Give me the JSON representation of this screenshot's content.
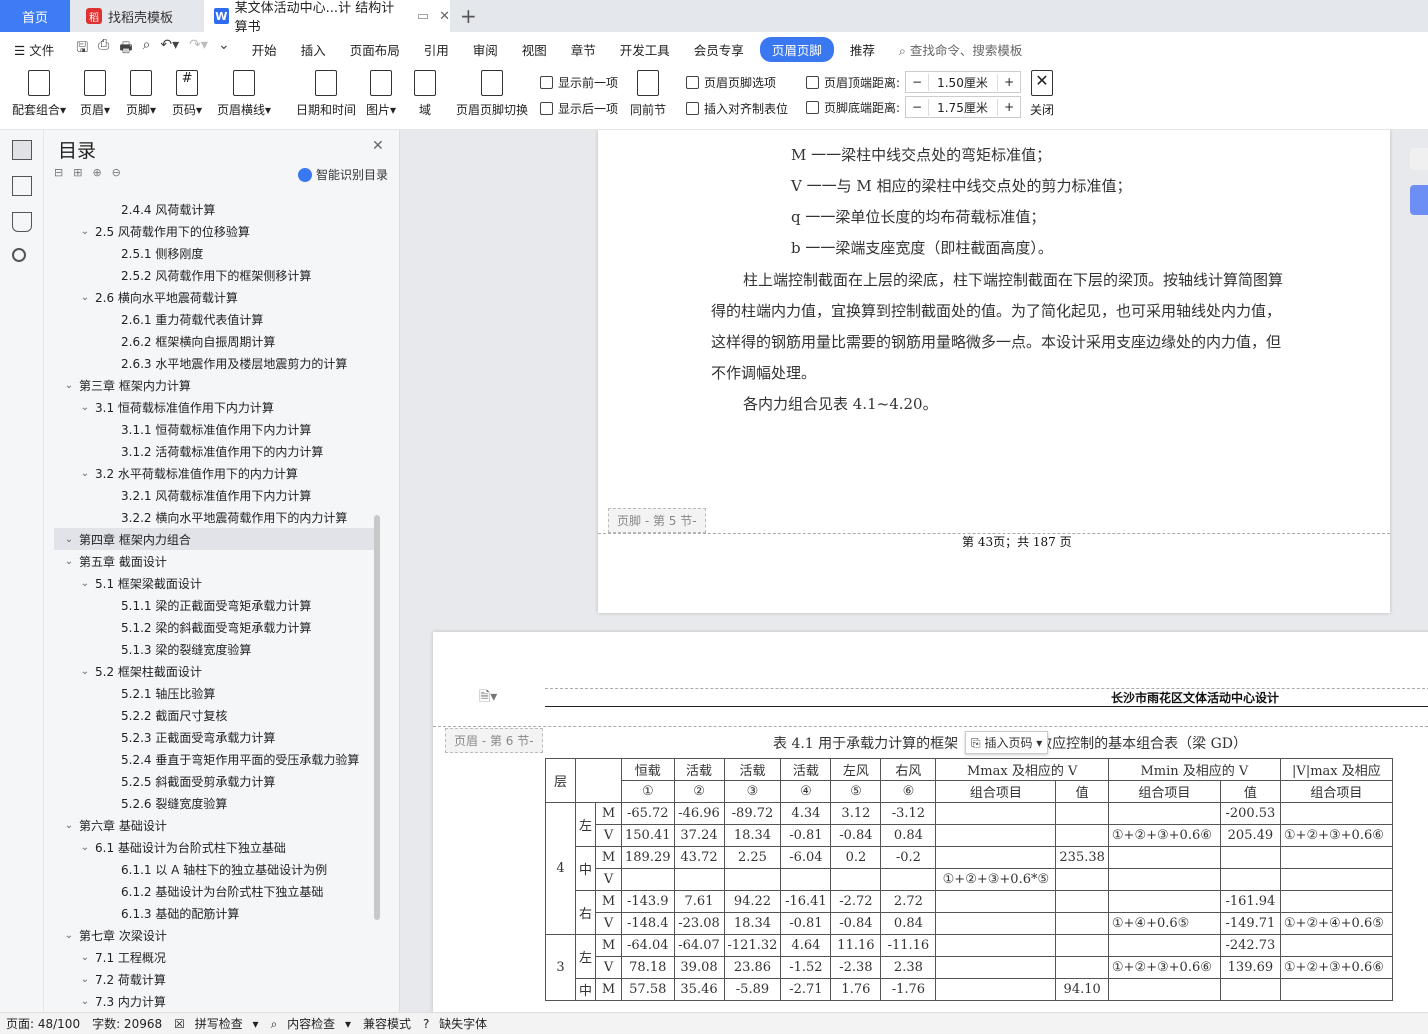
{
  "tabs": {
    "home": "首页",
    "template": "找稻壳模板",
    "doc": "某文体活动中心...计 结构计算书",
    "add": "+"
  },
  "menu": {
    "file": "文件",
    "items": [
      "开始",
      "插入",
      "页面布局",
      "引用",
      "审阅",
      "视图",
      "章节",
      "开发工具",
      "会员专享"
    ],
    "active": "页眉页脚",
    "recommend": "推荐",
    "search": "查找命令、搜索模板"
  },
  "toolbar": {
    "combo": "配套组合",
    "header": "页眉",
    "footer": "页脚",
    "pagenum": "页码",
    "headerline": "页眉横线",
    "datetime": "日期和时间",
    "image": "图片",
    "field": "域",
    "switch": "页眉页脚切换",
    "prev": "显示前一项",
    "next": "显示后一项",
    "same": "同前节",
    "options": "页眉页脚选项",
    "align_tab": "插入对齐制表位",
    "top_dist_label": "页眉顶端距离:",
    "top_dist": "1.50厘米",
    "bottom_dist_label": "页脚底端距离:",
    "bottom_dist": "1.75厘米",
    "close": "关闭"
  },
  "toc": {
    "title": "目录",
    "smart": "智能识别目录",
    "items": [
      {
        "t": "2.4.4  风荷载计算",
        "lvl": 3
      },
      {
        "t": "2.5  风荷载作用下的位移验算",
        "lvl": 2
      },
      {
        "t": "2.5.1  侧移刚度",
        "lvl": 3
      },
      {
        "t": "2.5.2  风荷载作用下的框架侧移计算",
        "lvl": 3
      },
      {
        "t": "2.6  横向水平地震荷载计算",
        "lvl": 2
      },
      {
        "t": "2.6.1  重力荷载代表值计算",
        "lvl": 3
      },
      {
        "t": "2.6.2  框架横向自振周期计算",
        "lvl": 3
      },
      {
        "t": "2.6.3 水平地震作用及楼层地震剪力的计算",
        "lvl": 3
      },
      {
        "t": "第三章  框架内力计算",
        "lvl": 1
      },
      {
        "t": "3.1  恒荷载标准值作用下内力计算",
        "lvl": 2
      },
      {
        "t": "3.1.1  恒荷载标准值作用下内力计算",
        "lvl": 3
      },
      {
        "t": "3.1.2  活荷载标准值作用下的内力计算",
        "lvl": 3
      },
      {
        "t": "3.2  水平荷载标准值作用下的内力计算",
        "lvl": 2
      },
      {
        "t": "3.2.1  风荷载标准值作用下内力计算",
        "lvl": 3
      },
      {
        "t": "3.2.2  横向水平地震荷载作用下的内力计算",
        "lvl": 3
      },
      {
        "t": "第四章  框架内力组合",
        "lvl": 1,
        "sel": true
      },
      {
        "t": "第五章  截面设计",
        "lvl": 1
      },
      {
        "t": "5.1  框架梁截面设计",
        "lvl": 2
      },
      {
        "t": "5.1.1  梁的正截面受弯矩承载力计算",
        "lvl": 3
      },
      {
        "t": "5.1.2  梁的斜截面受弯矩承载力计算",
        "lvl": 3
      },
      {
        "t": "5.1.3  梁的裂缝宽度验算",
        "lvl": 3
      },
      {
        "t": "5.2  框架柱截面设计",
        "lvl": 2
      },
      {
        "t": "5.2.1  轴压比验算",
        "lvl": 3
      },
      {
        "t": "5.2.2  截面尺寸复核",
        "lvl": 3
      },
      {
        "t": "5.2.3  正截面受弯承载力计算",
        "lvl": 3
      },
      {
        "t": "5.2.4  垂直于弯矩作用平面的受压承载力验算",
        "lvl": 3
      },
      {
        "t": "5.2.5  斜截面受剪承载力计算",
        "lvl": 3
      },
      {
        "t": "5.2.6  裂缝宽度验算",
        "lvl": 3
      },
      {
        "t": "第六章  基础设计",
        "lvl": 1
      },
      {
        "t": "6.1 基础设计为台阶式柱下独立基础",
        "lvl": 2
      },
      {
        "t": "6.1.1 以 A 轴柱下的独立基础设计为例",
        "lvl": 3
      },
      {
        "t": "6.1.2 基础设计为台阶式柱下独立基础",
        "lvl": 3
      },
      {
        "t": "6.1.3 基础的配筋计算",
        "lvl": 3
      },
      {
        "t": "第七章  次梁设计",
        "lvl": 1
      },
      {
        "t": "7.1  工程概况",
        "lvl": 2
      },
      {
        "t": "7.2  荷载计算",
        "lvl": 2
      },
      {
        "t": "7.3  内力计算",
        "lvl": 2
      }
    ]
  },
  "page5": {
    "lines": [
      "M 一一梁柱中线交点处的弯矩标准值；",
      "V 一一与 M 相应的梁柱中线交点处的剪力标准值；",
      "q 一一梁单位长度的均布荷载标准值；",
      "b 一一梁端支座宽度（即柱截面高度）。"
    ],
    "para": [
      "柱上端控制截面在上层的梁底，柱下端控制截面在下层的梁顶。按轴线计算简图算",
      "得的柱端内力值，宜换算到控制截面处的值。为了简化起见，也可采用轴线处内力值，",
      "这样得的钢筋用量比需要的钢筋用量略微多一点。本设计采用支座边缘处的内力值，但",
      "不作调幅处理。"
    ],
    "para2": "各内力组合见表 4.1~4.20。",
    "footer_label": "页脚 - 第 5 节-",
    "footer_text": "第 43页；共 187 页"
  },
  "page6": {
    "header_label": "页眉 - 第 6 节-",
    "header_text": "长沙市雨花区文体活动中心设计",
    "insert_pagenum": "插入页码",
    "table_title_a": "表 4.1    用于承载力计算的框架",
    "table_title_b": "效应控制的基本组合表（梁 GD）",
    "head1": [
      "层",
      "",
      "恒载",
      "活载",
      "活载",
      "活载",
      "左风",
      "右风",
      "Mmax 及相应的 V",
      "",
      "Mmin 及相应的 V",
      "",
      "|V|max 及相应"
    ],
    "head2": [
      "①",
      "②",
      "③",
      "④",
      "⑤",
      "⑥",
      "组合项目",
      "值",
      "组合项目",
      "值",
      "组合项目"
    ],
    "rows": [
      [
        "4",
        "左",
        "M",
        "-65.72",
        "-46.96",
        "-89.72",
        "4.34",
        "3.12",
        "-3.12",
        "",
        "",
        "",
        "-200.53",
        ""
      ],
      [
        "",
        "",
        "V",
        "150.41",
        "37.24",
        "18.34",
        "-0.81",
        "-0.84",
        "0.84",
        "",
        "",
        "①+②+③+0.6⑥",
        "205.49",
        "①+②+③+0.6⑥"
      ],
      [
        "",
        "中",
        "M",
        "189.29",
        "43.72",
        "2.25",
        "-6.04",
        "0.2",
        "-0.2",
        "",
        "235.38",
        "",
        "",
        ""
      ],
      [
        "",
        "",
        "V",
        "",
        "",
        "",
        "",
        "",
        "",
        "①+②+③+0.6*⑤",
        "",
        "",
        "",
        ""
      ],
      [
        "",
        "右",
        "M",
        "-143.9",
        "7.61",
        "94.22",
        "-16.41",
        "-2.72",
        "2.72",
        "",
        "",
        "",
        "-161.94",
        ""
      ],
      [
        "",
        "",
        "V",
        "-148.4",
        "-23.08",
        "18.34",
        "-0.81",
        "-0.84",
        "0.84",
        "",
        "",
        "①+④+0.6⑤",
        "-149.71",
        "①+②+④+0.6⑤"
      ],
      [
        "3",
        "左",
        "M",
        "-64.04",
        "-64.07",
        "-121.32",
        "4.64",
        "11.16",
        "-11.16",
        "",
        "",
        "",
        "-242.73",
        ""
      ],
      [
        "",
        "",
        "V",
        "78.18",
        "39.08",
        "23.86",
        "-1.52",
        "-2.38",
        "2.38",
        "",
        "",
        "①+②+③+0.6⑥",
        "139.69",
        "①+②+③+0.6⑥"
      ],
      [
        "",
        "中",
        "M",
        "57.58",
        "35.46",
        "-5.89",
        "-2.71",
        "1.76",
        "-1.76",
        "",
        "94.10",
        "",
        "",
        ""
      ]
    ]
  },
  "status": {
    "page": "页面: 48/100",
    "words": "字数: 20968",
    "spell": "拼写检查",
    "content": "内容检查",
    "compat": "兼容模式",
    "font": "缺失字体"
  }
}
